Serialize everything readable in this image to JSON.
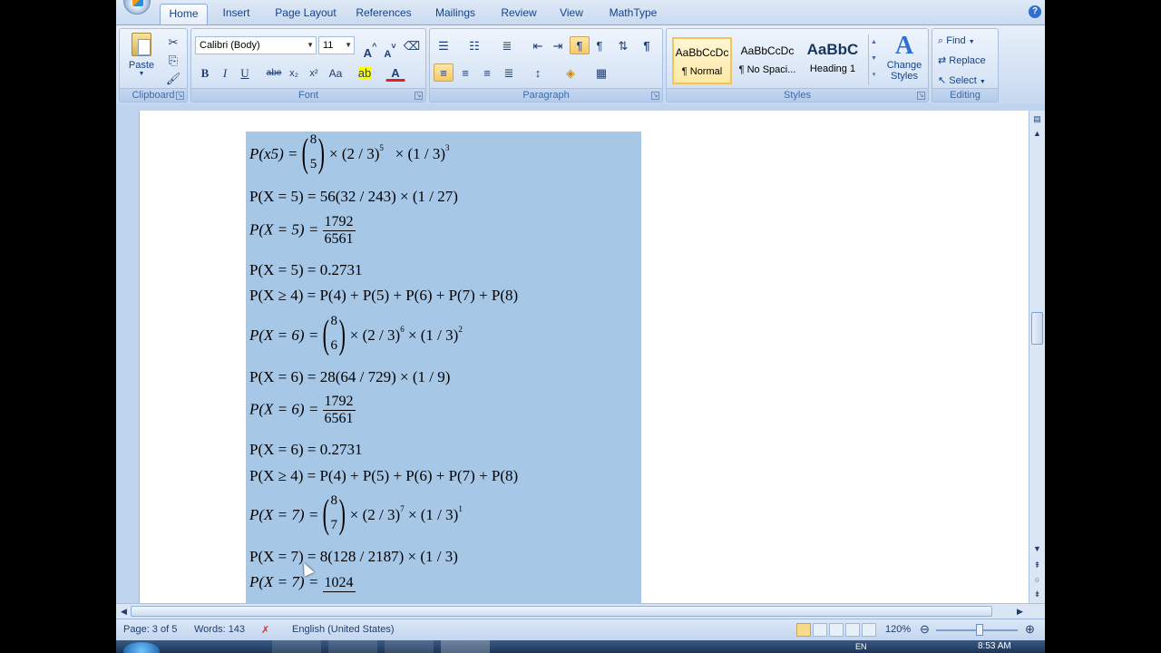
{
  "tabs": [
    "Home",
    "Insert",
    "Page Layout",
    "References",
    "Mailings",
    "Review",
    "View",
    "MathType"
  ],
  "clipboard": {
    "paste_label": "Paste",
    "group_label": "Clipboard"
  },
  "font": {
    "name": "Calibri (Body)",
    "size": "11",
    "group_label": "Font",
    "bold": "B",
    "italic": "I",
    "underline": "U",
    "strike": "abe",
    "subscript": "x₂",
    "superscript": "x²",
    "change_case": "Aa"
  },
  "paragraph": {
    "group_label": "Paragraph"
  },
  "styles": {
    "group_label": "Styles",
    "items": [
      {
        "preview": "AaBbCcDc",
        "name": "¶ Normal"
      },
      {
        "preview": "AaBbCcDc",
        "name": "¶ No Spaci..."
      },
      {
        "preview": "AaBbC",
        "name": "Heading 1"
      }
    ],
    "change_label_1": "Change",
    "change_label_2": "Styles"
  },
  "editing": {
    "group_label": "Editing",
    "find": "Find",
    "replace": "Replace",
    "select": "Select"
  },
  "equations": {
    "e1": {
      "lhs": "P(x5) =",
      "n": "8",
      "k": "5",
      "rest_a": "× (2 / 3)",
      "exp_a": "5",
      "rest_b": "× (1 / 3)",
      "exp_b": "3"
    },
    "e2": "P(X = 5) = 56(32 / 243) × (1 / 27)",
    "e3": {
      "lhs": "P(X = 5) =",
      "num": "1792",
      "den": "6561"
    },
    "e4": "P(X = 5) = 0.2731",
    "e5": "P(X ≥ 4) = P(4) + P(5) + P(6) + P(7) + P(8)",
    "e6": {
      "lhs": "P(X = 6) =",
      "n": "8",
      "k": "6",
      "rest_a": "× (2 / 3)",
      "exp_a": "6",
      "rest_b": "× (1 / 3)",
      "exp_b": "2"
    },
    "e7": "P(X = 6) = 28(64 / 729) × (1 / 9)",
    "e8": {
      "lhs": "P(X = 6) =",
      "num": "1792",
      "den": "6561"
    },
    "e9": "P(X = 6) = 0.2731",
    "e10": "P(X ≥ 4) = P(4) + P(5) + P(6) + P(7) + P(8)",
    "e11": {
      "lhs": "P(X = 7) =",
      "n": "8",
      "k": "7",
      "rest_a": "× (2 / 3)",
      "exp_a": "7",
      "rest_b": "× (1 / 3)",
      "exp_b": "1"
    },
    "e12": "P(X = 7) = 8(128 / 2187) × (1 / 3)",
    "e13": {
      "lhs": "P(X = 7) =",
      "num": "1024"
    }
  },
  "status": {
    "page": "Page: 3 of 5",
    "words": "Words: 143",
    "language": "English (United States)",
    "zoom": "120%"
  },
  "taskbar": {
    "clock": "8:53 AM",
    "lang": "EN"
  }
}
